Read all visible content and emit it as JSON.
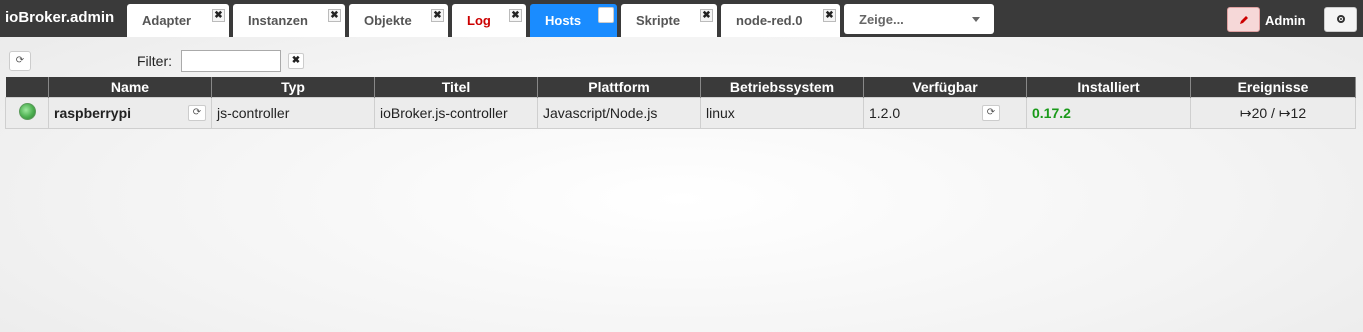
{
  "brand": "ioBroker.admin",
  "tabs": [
    {
      "label": "Adapter"
    },
    {
      "label": "Instanzen"
    },
    {
      "label": "Objekte"
    },
    {
      "label": "Log"
    },
    {
      "label": "Hosts"
    },
    {
      "label": "Skripte"
    },
    {
      "label": "node-red.0"
    }
  ],
  "tab_close_glyph": "✖",
  "select": {
    "label": "Zeige..."
  },
  "user": {
    "label": "Admin",
    "edit_icon": "pencil-icon"
  },
  "settings_icon": "gear-icon",
  "refresh_glyph": "⟳",
  "filter": {
    "label": "Filter:",
    "value": "",
    "clear_glyph": "✖"
  },
  "table": {
    "headers": [
      "",
      "Name",
      "Typ",
      "Titel",
      "Plattform",
      "Betriebssystem",
      "Verfügbar",
      "Installiert",
      "Ereignisse"
    ],
    "rows": [
      {
        "status_color": "#4caf50",
        "name": "raspberrypi",
        "typ": "js-controller",
        "titel": "ioBroker.js-controller",
        "plattform": "Javascript/Node.js",
        "os": "linux",
        "verfuegbar": "1.2.0",
        "installiert": "0.17.2",
        "ereignisse": "↦20 / ↦12"
      }
    ]
  },
  "colors": {
    "topbar": "#3a3a3a",
    "active_tab": "#1a8cff",
    "log_tab_text": "#cc0000",
    "installed": "#1a9a1a"
  }
}
